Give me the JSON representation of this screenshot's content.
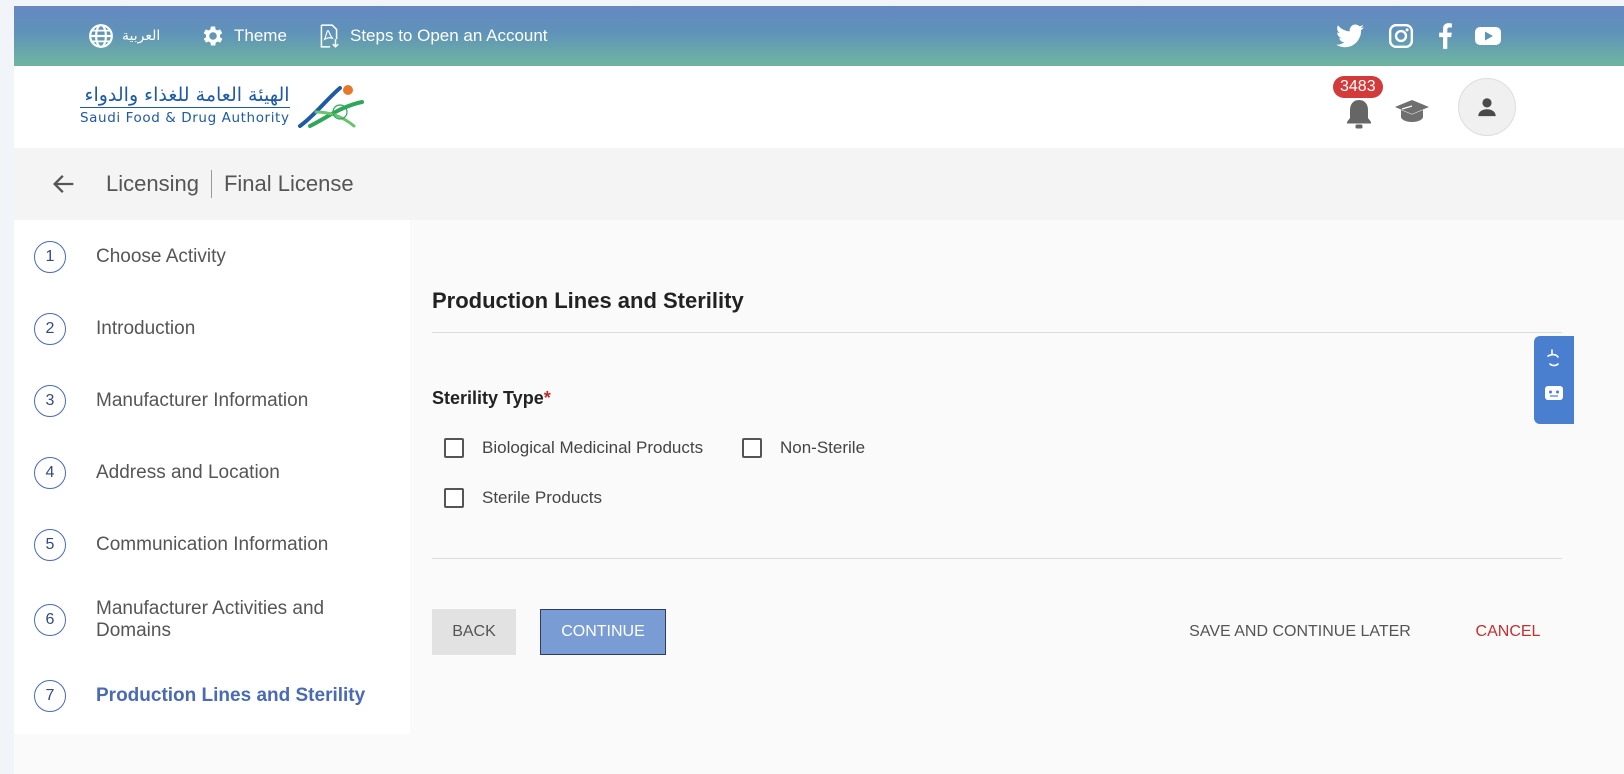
{
  "topbar": {
    "language_label": "العربية",
    "theme_label": "Theme",
    "steps_label": "Steps to Open an Account",
    "social_icons": [
      "twitter-icon",
      "instagram-icon",
      "facebook-icon",
      "youtube-icon"
    ]
  },
  "brand": {
    "logo_arabic": "الهيئة العامة للغذاء والدواء",
    "logo_english": "Saudi Food & Drug Authority",
    "notification_count": "3483"
  },
  "breadcrumb": {
    "section": "Licensing",
    "page": "Final License"
  },
  "steps": [
    {
      "number": "1",
      "label": "Choose Activity"
    },
    {
      "number": "2",
      "label": "Introduction"
    },
    {
      "number": "3",
      "label": "Manufacturer Information"
    },
    {
      "number": "4",
      "label": "Address and Location"
    },
    {
      "number": "5",
      "label": "Communication Information"
    },
    {
      "number": "6",
      "label": "Manufacturer Activities and Domains"
    },
    {
      "number": "7",
      "label": "Production Lines and Sterility"
    }
  ],
  "main": {
    "title": "Production Lines and Sterility",
    "sterility_label": "Sterility Type",
    "required_mark": "*",
    "options": [
      {
        "label": "Biological Medicinal Products",
        "checked": false
      },
      {
        "label": "Non-Sterile",
        "checked": false
      },
      {
        "label": "Sterile Products",
        "checked": false
      }
    ]
  },
  "buttons": {
    "back": "BACK",
    "continue": "CONTINUE",
    "save_later": "SAVE AND CONTINUE LATER",
    "cancel": "CANCEL"
  },
  "colors": {
    "primary": "#4a6ab2",
    "continue_button": "#7a9cd4",
    "cancel_text": "#c53030",
    "badge": "#d33b3b"
  }
}
